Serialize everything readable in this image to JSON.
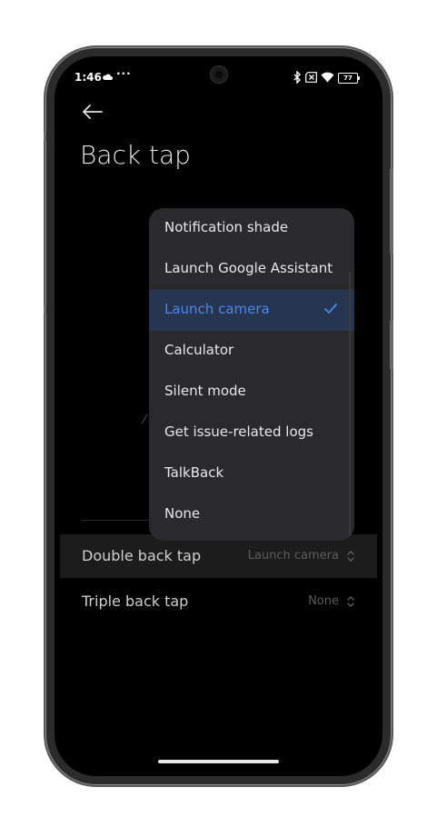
{
  "status_bar": {
    "time": "1:46",
    "extra_indicator": "···",
    "battery": "77"
  },
  "page": {
    "title": "Back tap"
  },
  "settings": [
    {
      "label": "Double back tap",
      "value": "Launch camera"
    },
    {
      "label": "Triple back tap",
      "value": "None"
    }
  ],
  "dropdown": {
    "selected": "Launch camera",
    "items": [
      {
        "label": "Notification shade"
      },
      {
        "label": "Launch Google Assistant"
      },
      {
        "label": "Launch camera"
      },
      {
        "label": "Calculator"
      },
      {
        "label": "Silent mode"
      },
      {
        "label": "Get issue-related logs"
      },
      {
        "label": "TalkBack"
      },
      {
        "label": "None"
      }
    ]
  },
  "colors": {
    "accent": "#4a86f0",
    "selected_bg": "#263550",
    "menu_bg": "#2a2a2c",
    "screen_bg": "#000000"
  },
  "icons": [
    "back-arrow-icon",
    "cloud-icon",
    "bluetooth-icon",
    "sim-icon",
    "wifi-icon",
    "battery-icon",
    "check-icon",
    "chevron-updown-icon"
  ]
}
